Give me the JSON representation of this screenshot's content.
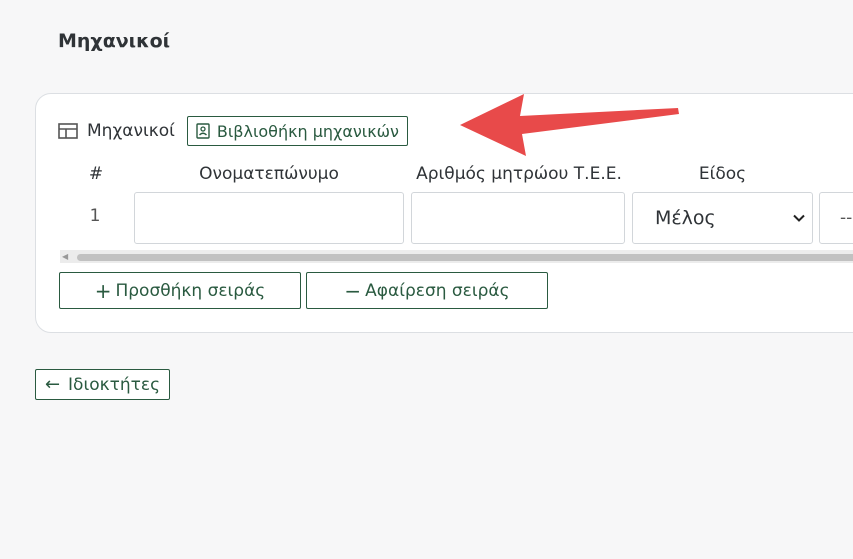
{
  "page": {
    "title": "Μηχανικοί"
  },
  "section": {
    "label": "Μηχανικοί",
    "library_button": "Βιβλιοθήκη μηχανικών"
  },
  "table": {
    "columns": [
      "#",
      "Ονοματεπώνυμο",
      "Αριθμός μητρώου Τ.Ε.Ε.",
      "Είδος"
    ],
    "rows": [
      {
        "index": "1",
        "name": "",
        "tee_number": "",
        "type": "Μέλος",
        "extra": "--"
      }
    ]
  },
  "actions": {
    "add_row": "Προσθήκη σειράς",
    "remove_row": "Αφαίρεση σειράς",
    "add_symbol": "+",
    "remove_symbol": "−"
  },
  "navigation": {
    "back_label": "Ιδιοκτήτες",
    "back_symbol": "←"
  },
  "colors": {
    "accent": "#2a5a40",
    "arrow": "#e84a4a"
  },
  "icons": [
    "table-icon",
    "contact-card-icon",
    "chevron-down-icon",
    "arrow-left-icon",
    "annotation-arrow"
  ]
}
